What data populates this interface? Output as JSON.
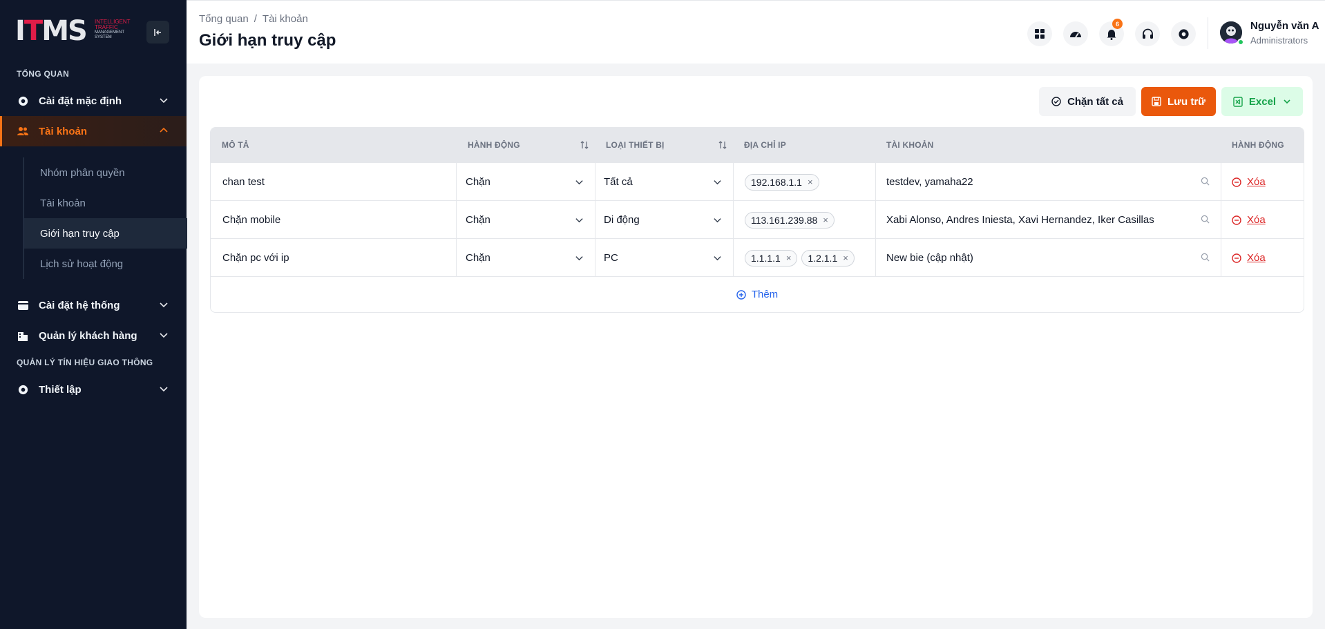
{
  "app": {
    "logo_mark": "ITMS",
    "logo_lines": [
      "INTELLIGENT",
      "TRAFFIC",
      "MANAGEMENT",
      "SYSTEM"
    ]
  },
  "sidebar": {
    "section_overview": "TỔNG QUAN",
    "section_traffic": "QUẢN LÝ TÍN HIỆU GIAO THÔNG",
    "items": [
      {
        "label": "Cài đặt mặc định",
        "icon": "gear-icon"
      },
      {
        "label": "Tài khoản",
        "icon": "users-icon"
      },
      {
        "label": "Cài đặt hệ thống",
        "icon": "card-icon"
      },
      {
        "label": "Quản lý khách hàng",
        "icon": "building-icon"
      },
      {
        "label": "Thiết lập",
        "icon": "gear-icon"
      }
    ],
    "sub_items": [
      {
        "label": "Nhóm phân quyền"
      },
      {
        "label": "Tài khoản"
      },
      {
        "label": "Giới hạn truy cập"
      },
      {
        "label": "Lịch sử hoạt động"
      }
    ]
  },
  "header": {
    "breadcrumb": [
      "Tổng quan",
      "Tài khoản"
    ],
    "breadcrumb_sep": "/",
    "title": "Giới hạn truy cập",
    "notification_count": "6",
    "user_name": "Nguyễn văn A",
    "user_role": "Administrators"
  },
  "toolbar": {
    "block_all_label": "Chặn tất cả",
    "save_label": "Lưu trữ",
    "excel_label": "Excel"
  },
  "table": {
    "columns": [
      "MÔ TẢ",
      "HÀNH ĐỘNG",
      "LOẠI THIẾT BỊ",
      "ĐỊA CHỈ IP",
      "TÀI KHOẢN",
      "HÀNH ĐỘNG"
    ],
    "rows": [
      {
        "desc": "chan test",
        "action": "Chặn",
        "device": "Tất cả",
        "ips": [
          "192.168.1.1"
        ],
        "accounts": "testdev, yamaha22",
        "delete": "Xóa"
      },
      {
        "desc": "Chặn mobile",
        "action": "Chặn",
        "device": "Di động",
        "ips": [
          "113.161.239.88"
        ],
        "accounts": "Xabi Alonso, Andres Iniesta, Xavi Hernandez, Iker Casillas",
        "delete": "Xóa"
      },
      {
        "desc": "Chặn pc với ip",
        "action": "Chặn",
        "device": "PC",
        "ips": [
          "1.1.1.1",
          "1.2.1.1"
        ],
        "accounts": "New bie (cập nhật)",
        "delete": "Xóa"
      }
    ],
    "tag_remove": "×",
    "add_label": "Thêm"
  },
  "colors": {
    "sidebar_bg": "#0f172a",
    "accent_orange": "#ea580c",
    "excel_green": "#16a34a",
    "danger_red": "#dc2626",
    "link_blue": "#2563eb"
  }
}
